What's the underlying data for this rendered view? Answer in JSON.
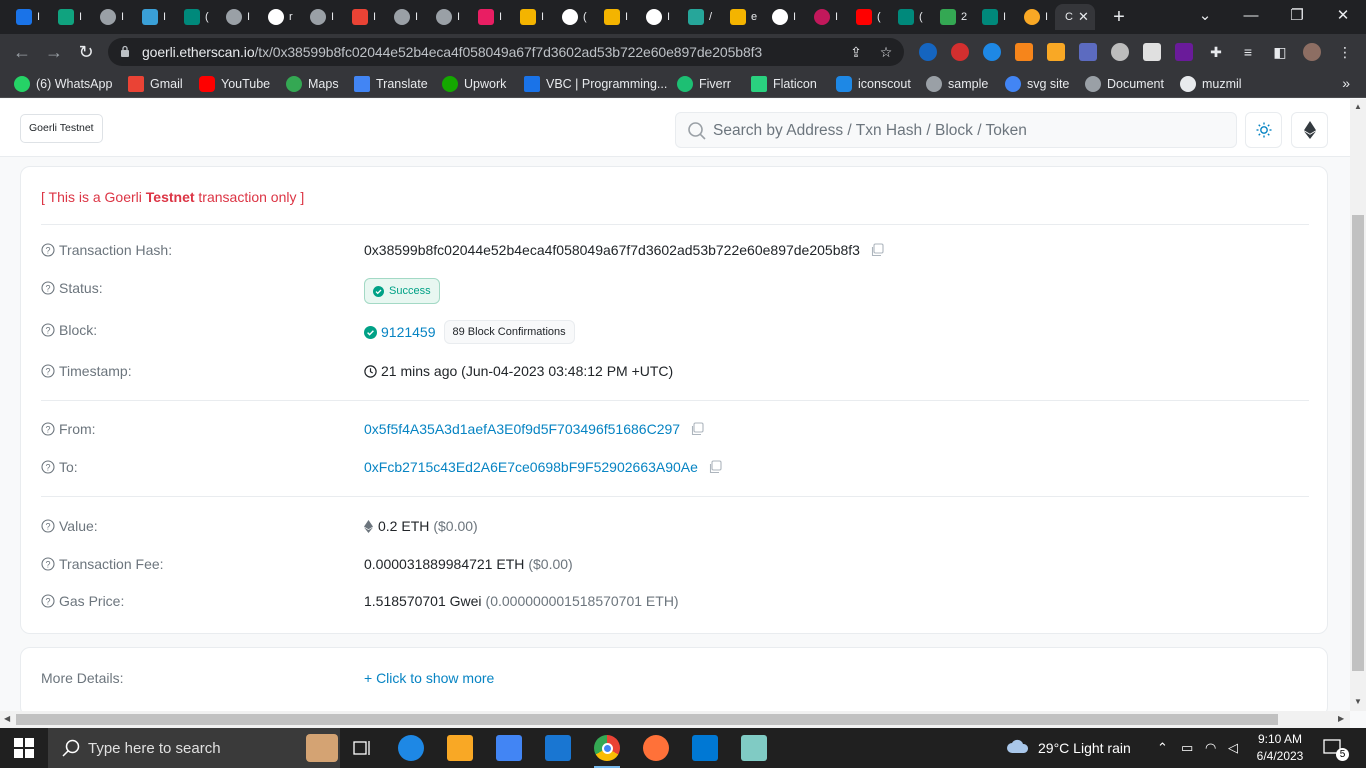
{
  "browser": {
    "url_host": "goerli.etherscan.io",
    "url_path": "/tx/0x38599b8fc02044e52b4eca4f058049a67f7d3602ad53b722e60e897de205b8f3",
    "bookmarks": [
      {
        "label": "(6) WhatsApp",
        "color": "#25d366"
      },
      {
        "label": "Gmail",
        "color": "#ea4335"
      },
      {
        "label": "YouTube",
        "color": "#ff0000"
      },
      {
        "label": "Maps",
        "color": "#34a853"
      },
      {
        "label": "Translate",
        "color": "#4285f4"
      },
      {
        "label": "Upwork",
        "color": "#14a800"
      },
      {
        "label": "VBC | Programming...",
        "color": "#1a73e8"
      },
      {
        "label": "Fiverr",
        "color": "#1dbf73"
      },
      {
        "label": "Flaticon",
        "color": "#2ad17f"
      },
      {
        "label": "iconscout",
        "color": "#1e88e5"
      },
      {
        "label": "sample",
        "color": "#9aa0a6"
      },
      {
        "label": "svg site",
        "color": "#4285f4"
      },
      {
        "label": "Document",
        "color": "#9aa0a6"
      },
      {
        "label": "muzmil",
        "color": "#e8eaed"
      }
    ],
    "bookmarks_more": "»"
  },
  "header": {
    "network_badge": "Goerli Testnet",
    "search_placeholder": "Search by Address / Txn Hash / Block / Token"
  },
  "notice": {
    "prefix": "[ This is a Goerli ",
    "bold": "Testnet",
    "suffix": " transaction only ]"
  },
  "tx": {
    "hash_label": "Transaction Hash:",
    "hash": "0x38599b8fc02044e52b4eca4f058049a67f7d3602ad53b722e60e897de205b8f3",
    "status_label": "Status:",
    "status": "Success",
    "block_label": "Block:",
    "block": "9121459",
    "confirmations": "89 Block Confirmations",
    "timestamp_label": "Timestamp:",
    "timestamp": "21 mins ago (Jun-04-2023 03:48:12 PM +UTC)",
    "from_label": "From:",
    "from": "0x5f5f4A35A3d1aefA3E0f9d5F703496f51686C297",
    "to_label": "To:",
    "to": "0xFcb2715c43Ed2A6E7ce0698bF9F52902663A90Ae",
    "value_label": "Value:",
    "value": "0.2 ETH",
    "value_usd": "($0.00)",
    "fee_label": "Transaction Fee:",
    "fee": "0.000031889984721 ETH",
    "fee_usd": "($0.00)",
    "gas_label": "Gas Price:",
    "gas": "1.518570701 Gwei",
    "gas_eth": "(0.000000001518570701 ETH)"
  },
  "more": {
    "label": "More Details:",
    "link": "+ Click to show more"
  },
  "taskbar": {
    "search_text": "Type here to search",
    "weather": "29°C  Light rain",
    "time": "9:10 AM",
    "date": "6/4/2023",
    "notifications": "5"
  },
  "colors": {
    "link": "#0784c3",
    "danger": "#dc3545",
    "success": "#00a186"
  }
}
